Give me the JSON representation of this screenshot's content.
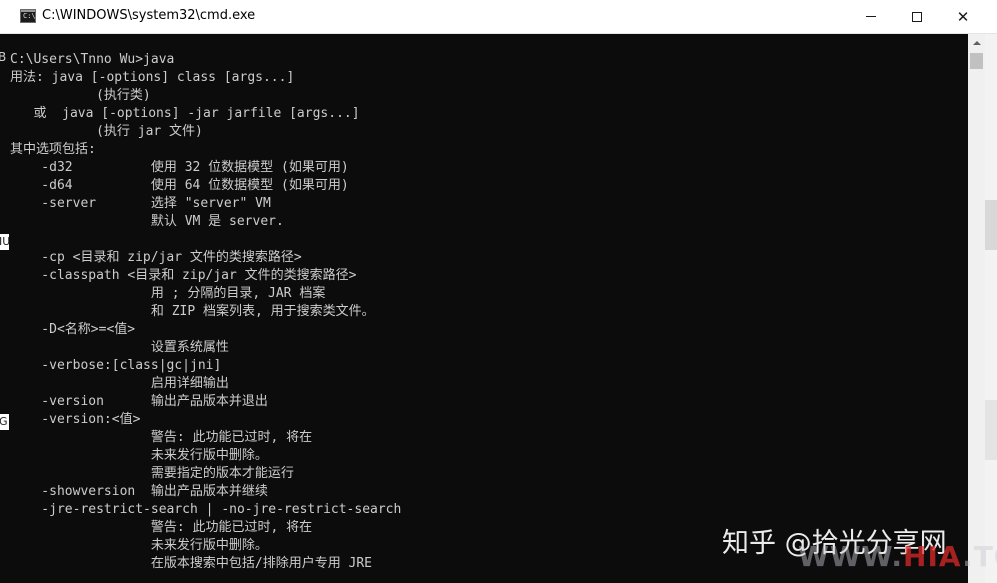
{
  "window": {
    "title": "C:\\WINDOWS\\system32\\cmd.exe",
    "icon": "cmd-icon",
    "icon_text": "C:\\"
  },
  "controls": {
    "close_glyph": "✕"
  },
  "left_edge": {
    "fragments": [
      "B",
      "IU",
      "G"
    ]
  },
  "console": {
    "lines": [
      "C:\\Users\\Tnno Wu>java",
      "用法: java [-options] class [args...]",
      "           (执行类)",
      "   或  java [-options] -jar jarfile [args...]",
      "           (执行 jar 文件)",
      "其中选项包括:",
      "    -d32          使用 32 位数据模型 (如果可用)",
      "    -d64          使用 64 位数据模型 (如果可用)",
      "    -server       选择 \"server\" VM",
      "                  默认 VM 是 server.",
      "",
      "    -cp <目录和 zip/jar 文件的类搜索路径>",
      "    -classpath <目录和 zip/jar 文件的类搜索路径>",
      "                  用 ; 分隔的目录, JAR 档案",
      "                  和 ZIP 档案列表, 用于搜索类文件。",
      "    -D<名称>=<值>",
      "                  设置系统属性",
      "    -verbose:[class|gc|jni]",
      "                  启用详细输出",
      "    -version      输出产品版本并退出",
      "    -version:<值>",
      "                  警告: 此功能已过时, 将在",
      "                  未来发行版中删除。",
      "                  需要指定的版本才能运行",
      "    -showversion  输出产品版本并继续",
      "    -jre-restrict-search | -no-jre-restrict-search",
      "                  警告: 此功能已过时, 将在",
      "                  未来发行版中删除。",
      "                  在版本搜索中包括/排除用户专用 JRE"
    ]
  },
  "watermark": {
    "text": "知乎 @拾光分享网",
    "site_prefix": "WWW.",
    "site_highlight": "HIA",
    "site_suffix": ".TOP"
  },
  "colors": {
    "console_bg": "#0c0c0c",
    "console_fg": "#cccccc",
    "titlebar_bg": "#ffffff"
  }
}
